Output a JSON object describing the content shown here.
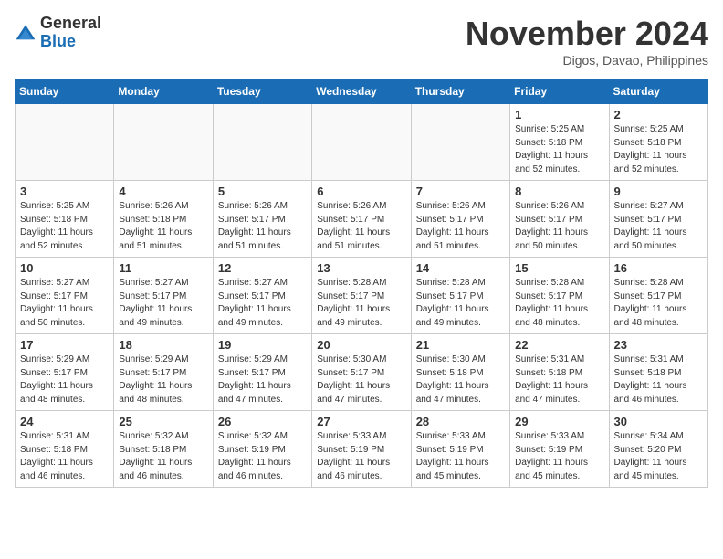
{
  "header": {
    "logo_general": "General",
    "logo_blue": "Blue",
    "month_title": "November 2024",
    "location": "Digos, Davao, Philippines"
  },
  "days_of_week": [
    "Sunday",
    "Monday",
    "Tuesday",
    "Wednesday",
    "Thursday",
    "Friday",
    "Saturday"
  ],
  "weeks": [
    [
      {
        "day": "",
        "info": ""
      },
      {
        "day": "",
        "info": ""
      },
      {
        "day": "",
        "info": ""
      },
      {
        "day": "",
        "info": ""
      },
      {
        "day": "",
        "info": ""
      },
      {
        "day": "1",
        "info": "Sunrise: 5:25 AM\nSunset: 5:18 PM\nDaylight: 11 hours and 52 minutes."
      },
      {
        "day": "2",
        "info": "Sunrise: 5:25 AM\nSunset: 5:18 PM\nDaylight: 11 hours and 52 minutes."
      }
    ],
    [
      {
        "day": "3",
        "info": "Sunrise: 5:25 AM\nSunset: 5:18 PM\nDaylight: 11 hours and 52 minutes."
      },
      {
        "day": "4",
        "info": "Sunrise: 5:26 AM\nSunset: 5:18 PM\nDaylight: 11 hours and 51 minutes."
      },
      {
        "day": "5",
        "info": "Sunrise: 5:26 AM\nSunset: 5:17 PM\nDaylight: 11 hours and 51 minutes."
      },
      {
        "day": "6",
        "info": "Sunrise: 5:26 AM\nSunset: 5:17 PM\nDaylight: 11 hours and 51 minutes."
      },
      {
        "day": "7",
        "info": "Sunrise: 5:26 AM\nSunset: 5:17 PM\nDaylight: 11 hours and 51 minutes."
      },
      {
        "day": "8",
        "info": "Sunrise: 5:26 AM\nSunset: 5:17 PM\nDaylight: 11 hours and 50 minutes."
      },
      {
        "day": "9",
        "info": "Sunrise: 5:27 AM\nSunset: 5:17 PM\nDaylight: 11 hours and 50 minutes."
      }
    ],
    [
      {
        "day": "10",
        "info": "Sunrise: 5:27 AM\nSunset: 5:17 PM\nDaylight: 11 hours and 50 minutes."
      },
      {
        "day": "11",
        "info": "Sunrise: 5:27 AM\nSunset: 5:17 PM\nDaylight: 11 hours and 49 minutes."
      },
      {
        "day": "12",
        "info": "Sunrise: 5:27 AM\nSunset: 5:17 PM\nDaylight: 11 hours and 49 minutes."
      },
      {
        "day": "13",
        "info": "Sunrise: 5:28 AM\nSunset: 5:17 PM\nDaylight: 11 hours and 49 minutes."
      },
      {
        "day": "14",
        "info": "Sunrise: 5:28 AM\nSunset: 5:17 PM\nDaylight: 11 hours and 49 minutes."
      },
      {
        "day": "15",
        "info": "Sunrise: 5:28 AM\nSunset: 5:17 PM\nDaylight: 11 hours and 48 minutes."
      },
      {
        "day": "16",
        "info": "Sunrise: 5:28 AM\nSunset: 5:17 PM\nDaylight: 11 hours and 48 minutes."
      }
    ],
    [
      {
        "day": "17",
        "info": "Sunrise: 5:29 AM\nSunset: 5:17 PM\nDaylight: 11 hours and 48 minutes."
      },
      {
        "day": "18",
        "info": "Sunrise: 5:29 AM\nSunset: 5:17 PM\nDaylight: 11 hours and 48 minutes."
      },
      {
        "day": "19",
        "info": "Sunrise: 5:29 AM\nSunset: 5:17 PM\nDaylight: 11 hours and 47 minutes."
      },
      {
        "day": "20",
        "info": "Sunrise: 5:30 AM\nSunset: 5:17 PM\nDaylight: 11 hours and 47 minutes."
      },
      {
        "day": "21",
        "info": "Sunrise: 5:30 AM\nSunset: 5:18 PM\nDaylight: 11 hours and 47 minutes."
      },
      {
        "day": "22",
        "info": "Sunrise: 5:31 AM\nSunset: 5:18 PM\nDaylight: 11 hours and 47 minutes."
      },
      {
        "day": "23",
        "info": "Sunrise: 5:31 AM\nSunset: 5:18 PM\nDaylight: 11 hours and 46 minutes."
      }
    ],
    [
      {
        "day": "24",
        "info": "Sunrise: 5:31 AM\nSunset: 5:18 PM\nDaylight: 11 hours and 46 minutes."
      },
      {
        "day": "25",
        "info": "Sunrise: 5:32 AM\nSunset: 5:18 PM\nDaylight: 11 hours and 46 minutes."
      },
      {
        "day": "26",
        "info": "Sunrise: 5:32 AM\nSunset: 5:19 PM\nDaylight: 11 hours and 46 minutes."
      },
      {
        "day": "27",
        "info": "Sunrise: 5:33 AM\nSunset: 5:19 PM\nDaylight: 11 hours and 46 minutes."
      },
      {
        "day": "28",
        "info": "Sunrise: 5:33 AM\nSunset: 5:19 PM\nDaylight: 11 hours and 45 minutes."
      },
      {
        "day": "29",
        "info": "Sunrise: 5:33 AM\nSunset: 5:19 PM\nDaylight: 11 hours and 45 minutes."
      },
      {
        "day": "30",
        "info": "Sunrise: 5:34 AM\nSunset: 5:20 PM\nDaylight: 11 hours and 45 minutes."
      }
    ]
  ]
}
